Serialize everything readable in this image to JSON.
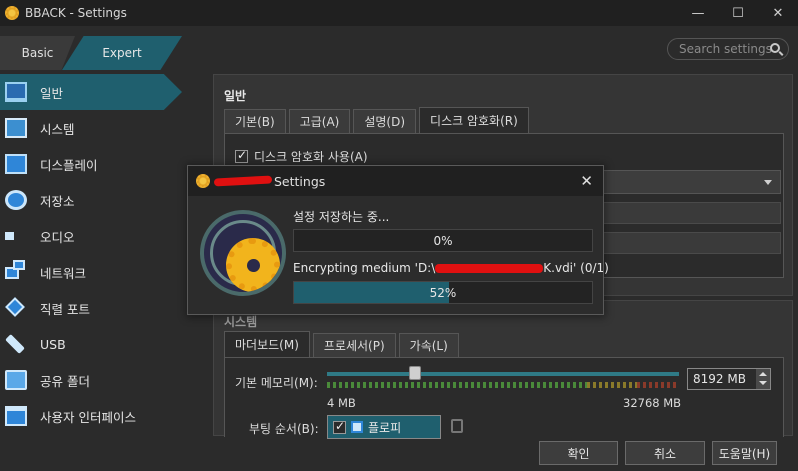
{
  "window": {
    "title": "BBACK - Settings",
    "minimize": "—",
    "maximize": "☐",
    "close": "✕"
  },
  "mode_tabs": {
    "basic": "Basic",
    "expert": "Expert"
  },
  "search": {
    "placeholder": "Search settings"
  },
  "sidebar": {
    "items": [
      {
        "label": "일반",
        "icon": "general-monitor-icon"
      },
      {
        "label": "시스템",
        "icon": "system-chip-icon"
      },
      {
        "label": "디스플레이",
        "icon": "display-icon"
      },
      {
        "label": "저장소",
        "icon": "storage-disk-icon"
      },
      {
        "label": "오디오",
        "icon": "audio-speaker-icon"
      },
      {
        "label": "네트워크",
        "icon": "network-icon"
      },
      {
        "label": "직렬 포트",
        "icon": "serial-port-icon"
      },
      {
        "label": "USB",
        "icon": "usb-icon"
      },
      {
        "label": "공유 폴더",
        "icon": "shared-folder-icon"
      },
      {
        "label": "사용자 인터페이스",
        "icon": "user-interface-icon"
      }
    ]
  },
  "general": {
    "title": "일반",
    "tabs": [
      "기본(B)",
      "고급(A)",
      "설명(D)",
      "디스크 암호화(R)"
    ],
    "enable_encryption": "디스크 암호화 사용(A)"
  },
  "system": {
    "title": "시스템",
    "tabs": [
      "마더보드(M)",
      "프로세서(P)",
      "가속(L)"
    ],
    "memory_label": "기본 메모리(M):",
    "memory_min": "4 MB",
    "memory_max": "32768 MB",
    "memory_value": "8192 MB",
    "memory_slider_fraction": 0.25,
    "boot_label": "부팅 순서(B):",
    "boot_item": "플로피"
  },
  "buttons": {
    "ok": "확인",
    "cancel": "취소",
    "help": "도움말(H)"
  },
  "dialog": {
    "title": "Settings",
    "close": "✕",
    "operation_text": "설정 저장하는 중...",
    "operation_percent": 0,
    "operation_percent_label": "0%",
    "sub_text_prefix": "Encrypting medium 'D:\\",
    "sub_text_suffix": "K.vdi' (0/1)",
    "sub_percent": 52,
    "sub_percent_label": "52%"
  },
  "colors": {
    "accent": "#1f5f6e",
    "background": "#2b2b2b",
    "redaction": "#e01010"
  }
}
